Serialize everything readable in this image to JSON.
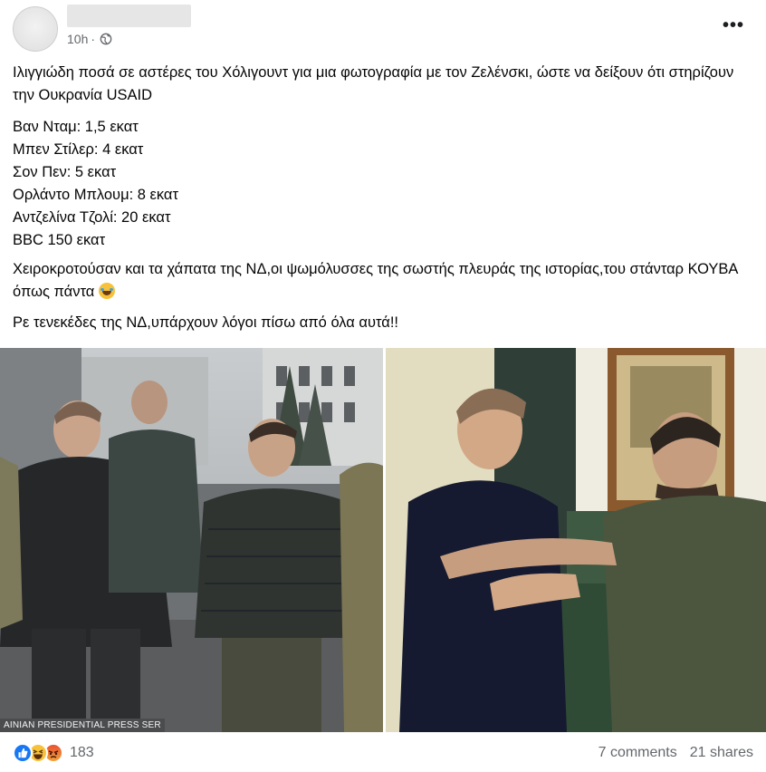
{
  "post": {
    "timestamp": "10h",
    "privacy_icon": "globe-icon",
    "more_icon": "more-options-icon",
    "text": {
      "para1": "Ιλιγγιώδη ποσά σε αστέρες του Χόλιγουντ για μια φωτογραφία με τον Ζελένσκι, ώστε να δείξουν ότι στηρίζουν την Ουκρανία USAID",
      "list": [
        "Βαν Νταμ: 1,5 εκατ",
        "Μπεν Στίλερ: 4 εκατ",
        "Σον Πεν: 5 εκατ",
        "Ορλάντο Μπλουμ: 8 εκατ",
        "Αντζελίνα Τζολί: 20 εκατ",
        "BBC 150 εκατ"
      ],
      "para2": "Χειροκροτούσαν και τα χάπατα της ΝΔ,οι ψωμόλυσσες της σωστής πλευράς της ιστορίας,του στάνταρ ΚΟΥΒΑ όπως πάντα",
      "para3": "Ρε τενεκέδες της ΝΔ,υπάρχουν λόγοι πίσω από όλα αυτά!!"
    },
    "photo_caption": "AINIAN PRESIDENTIAL PRESS SER"
  },
  "footer": {
    "reaction_icons": [
      "like-icon",
      "haha-icon",
      "angry-icon"
    ],
    "reaction_count": "183",
    "comments": "7 comments",
    "shares": "21 shares"
  },
  "colors": {
    "secondary_text": "#65676b",
    "like_blue": "#1877f2"
  }
}
